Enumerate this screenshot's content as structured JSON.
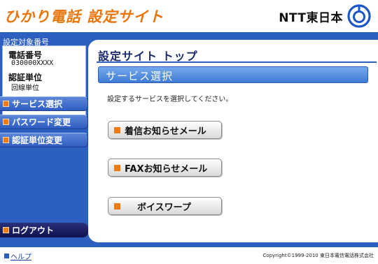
{
  "header": {
    "app_title": "ひかり電話 設定サイト",
    "brand_text": "NTT東日本",
    "brand_logo_icon": "ntt-logo-icon",
    "accent_color": "#e8740a",
    "frame_color": "#2d5fc0"
  },
  "sidebar": {
    "id_box_label": "設定対象番号",
    "phone_label": "電話番号",
    "phone_value": "030000XXXX",
    "auth_label": "認証単位",
    "auth_value": "回線単位",
    "nav_items": [
      {
        "label": "サービス選択"
      },
      {
        "label": "パスワード変更"
      },
      {
        "label": "認証単位変更"
      }
    ],
    "logout_label": "ログアウト"
  },
  "main": {
    "page_title": "設定サイト トップ",
    "section_title": "サービス選択",
    "instruction": "設定するサービスを選択してください。",
    "services": [
      {
        "label": "着信お知らせメール"
      },
      {
        "label": "FAXお知らせメール"
      },
      {
        "label": "ボイスワープ"
      }
    ]
  },
  "footer": {
    "help_label": "ヘルプ",
    "copyright": "Copyright©1999-2010 東日本電信電話株式会社"
  }
}
